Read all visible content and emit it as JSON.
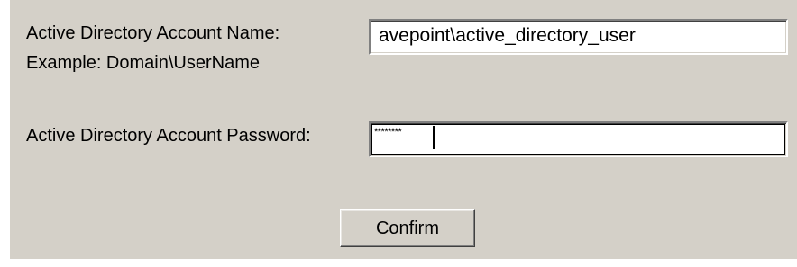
{
  "form": {
    "account_name_label": "Active Directory Account Name:",
    "account_name_example": "Example: Domain\\UserName",
    "account_name_value": "avepoint\\active_directory_user",
    "password_label": "Active Directory Account Password:",
    "password_value": "********"
  },
  "actions": {
    "confirm_label": "Confirm"
  }
}
